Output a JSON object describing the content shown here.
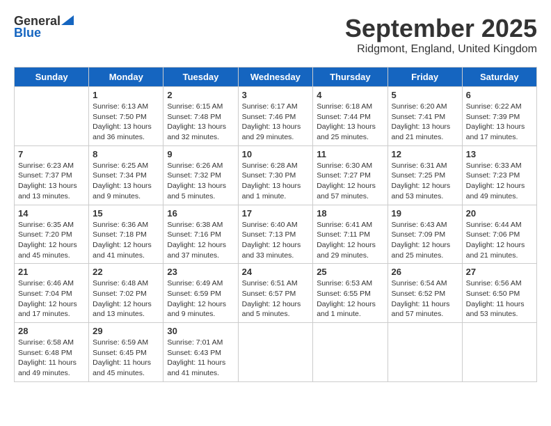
{
  "logo": {
    "general": "General",
    "blue": "Blue"
  },
  "title": "September 2025",
  "location": "Ridgmont, England, United Kingdom",
  "days_of_week": [
    "Sunday",
    "Monday",
    "Tuesday",
    "Wednesday",
    "Thursday",
    "Friday",
    "Saturday"
  ],
  "weeks": [
    [
      {
        "day": "",
        "info": ""
      },
      {
        "day": "1",
        "info": "Sunrise: 6:13 AM\nSunset: 7:50 PM\nDaylight: 13 hours\nand 36 minutes."
      },
      {
        "day": "2",
        "info": "Sunrise: 6:15 AM\nSunset: 7:48 PM\nDaylight: 13 hours\nand 32 minutes."
      },
      {
        "day": "3",
        "info": "Sunrise: 6:17 AM\nSunset: 7:46 PM\nDaylight: 13 hours\nand 29 minutes."
      },
      {
        "day": "4",
        "info": "Sunrise: 6:18 AM\nSunset: 7:44 PM\nDaylight: 13 hours\nand 25 minutes."
      },
      {
        "day": "5",
        "info": "Sunrise: 6:20 AM\nSunset: 7:41 PM\nDaylight: 13 hours\nand 21 minutes."
      },
      {
        "day": "6",
        "info": "Sunrise: 6:22 AM\nSunset: 7:39 PM\nDaylight: 13 hours\nand 17 minutes."
      }
    ],
    [
      {
        "day": "7",
        "info": "Sunrise: 6:23 AM\nSunset: 7:37 PM\nDaylight: 13 hours\nand 13 minutes."
      },
      {
        "day": "8",
        "info": "Sunrise: 6:25 AM\nSunset: 7:34 PM\nDaylight: 13 hours\nand 9 minutes."
      },
      {
        "day": "9",
        "info": "Sunrise: 6:26 AM\nSunset: 7:32 PM\nDaylight: 13 hours\nand 5 minutes."
      },
      {
        "day": "10",
        "info": "Sunrise: 6:28 AM\nSunset: 7:30 PM\nDaylight: 13 hours\nand 1 minute."
      },
      {
        "day": "11",
        "info": "Sunrise: 6:30 AM\nSunset: 7:27 PM\nDaylight: 12 hours\nand 57 minutes."
      },
      {
        "day": "12",
        "info": "Sunrise: 6:31 AM\nSunset: 7:25 PM\nDaylight: 12 hours\nand 53 minutes."
      },
      {
        "day": "13",
        "info": "Sunrise: 6:33 AM\nSunset: 7:23 PM\nDaylight: 12 hours\nand 49 minutes."
      }
    ],
    [
      {
        "day": "14",
        "info": "Sunrise: 6:35 AM\nSunset: 7:20 PM\nDaylight: 12 hours\nand 45 minutes."
      },
      {
        "day": "15",
        "info": "Sunrise: 6:36 AM\nSunset: 7:18 PM\nDaylight: 12 hours\nand 41 minutes."
      },
      {
        "day": "16",
        "info": "Sunrise: 6:38 AM\nSunset: 7:16 PM\nDaylight: 12 hours\nand 37 minutes."
      },
      {
        "day": "17",
        "info": "Sunrise: 6:40 AM\nSunset: 7:13 PM\nDaylight: 12 hours\nand 33 minutes."
      },
      {
        "day": "18",
        "info": "Sunrise: 6:41 AM\nSunset: 7:11 PM\nDaylight: 12 hours\nand 29 minutes."
      },
      {
        "day": "19",
        "info": "Sunrise: 6:43 AM\nSunset: 7:09 PM\nDaylight: 12 hours\nand 25 minutes."
      },
      {
        "day": "20",
        "info": "Sunrise: 6:44 AM\nSunset: 7:06 PM\nDaylight: 12 hours\nand 21 minutes."
      }
    ],
    [
      {
        "day": "21",
        "info": "Sunrise: 6:46 AM\nSunset: 7:04 PM\nDaylight: 12 hours\nand 17 minutes."
      },
      {
        "day": "22",
        "info": "Sunrise: 6:48 AM\nSunset: 7:02 PM\nDaylight: 12 hours\nand 13 minutes."
      },
      {
        "day": "23",
        "info": "Sunrise: 6:49 AM\nSunset: 6:59 PM\nDaylight: 12 hours\nand 9 minutes."
      },
      {
        "day": "24",
        "info": "Sunrise: 6:51 AM\nSunset: 6:57 PM\nDaylight: 12 hours\nand 5 minutes."
      },
      {
        "day": "25",
        "info": "Sunrise: 6:53 AM\nSunset: 6:55 PM\nDaylight: 12 hours\nand 1 minute."
      },
      {
        "day": "26",
        "info": "Sunrise: 6:54 AM\nSunset: 6:52 PM\nDaylight: 11 hours\nand 57 minutes."
      },
      {
        "day": "27",
        "info": "Sunrise: 6:56 AM\nSunset: 6:50 PM\nDaylight: 11 hours\nand 53 minutes."
      }
    ],
    [
      {
        "day": "28",
        "info": "Sunrise: 6:58 AM\nSunset: 6:48 PM\nDaylight: 11 hours\nand 49 minutes."
      },
      {
        "day": "29",
        "info": "Sunrise: 6:59 AM\nSunset: 6:45 PM\nDaylight: 11 hours\nand 45 minutes."
      },
      {
        "day": "30",
        "info": "Sunrise: 7:01 AM\nSunset: 6:43 PM\nDaylight: 11 hours\nand 41 minutes."
      },
      {
        "day": "",
        "info": ""
      },
      {
        "day": "",
        "info": ""
      },
      {
        "day": "",
        "info": ""
      },
      {
        "day": "",
        "info": ""
      }
    ]
  ]
}
